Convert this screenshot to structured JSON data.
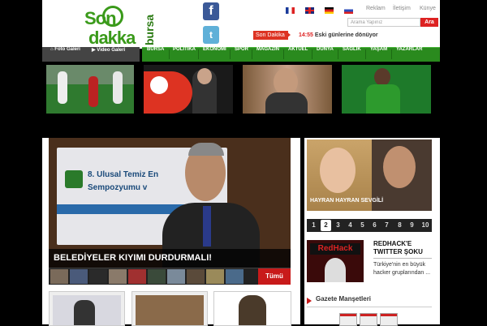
{
  "logo": {
    "line1": "Son",
    "line2": "dakka",
    "side": "bursa"
  },
  "social": {
    "facebook": "f",
    "twitter": "t"
  },
  "top_links": [
    "Reklam",
    "İletişim",
    "Künye"
  ],
  "search": {
    "placeholder": "Arama Yapınız",
    "button": "Ara"
  },
  "ticker": {
    "label": "Son Dakika",
    "time": "14:55",
    "headline": "Eski günlerine dönüyor"
  },
  "gallery_nav": [
    "Foto Galeri",
    "Video Galeri"
  ],
  "nav": [
    "BURSA",
    "POLİTİKA",
    "EKONOMİ",
    "SPOR",
    "MAGAZİN",
    "AKTÜEL",
    "DÜNYA",
    "SAĞLIK",
    "YAŞAM",
    "YAZARLAR"
  ],
  "hero": {
    "title": "BELEDİYELER KIYIMI DURDURMALI!",
    "banner_line1": "8. Ulusal Temiz En",
    "banner_line2": "Sempozyumu v",
    "more": "Tümü"
  },
  "right_feature": {
    "caption": "HAYRAN HAYRAN SEVGİLİ",
    "pages": [
      "1",
      "2",
      "3",
      "4",
      "5",
      "6",
      "7",
      "8",
      "9",
      "10"
    ],
    "active_page": "2"
  },
  "side_story": {
    "title": "REDHACK'E TWITTER ŞOKU",
    "desc": "Türkiye'nin en büyük hacker gruplarından ...",
    "img_text": "RedHack"
  },
  "gazete": {
    "title": "Gazete Manşetleri"
  },
  "colors": {
    "green": "#2a8a1e",
    "red": "#c81a1a"
  }
}
